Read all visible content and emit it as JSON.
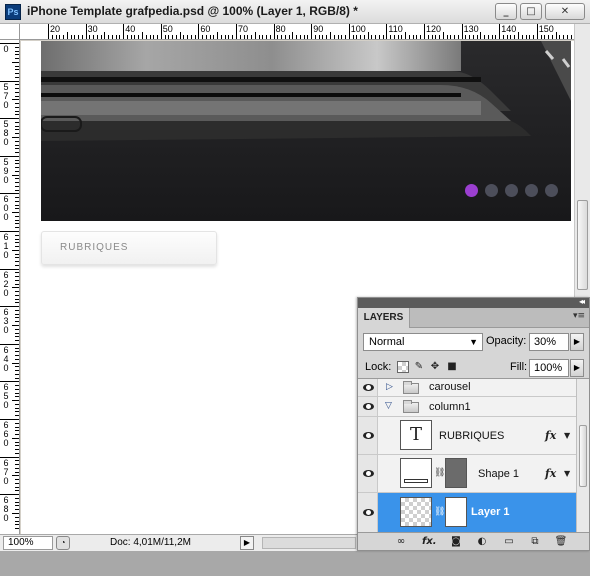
{
  "window": {
    "app_icon": "Ps",
    "title": "iPhone Template grafpedia.psd @ 100% (Layer 1, RGB/8) *",
    "buttons": [
      "minimize-icon",
      "maximize-icon",
      "close-icon"
    ]
  },
  "rulers": {
    "horizontal_labels": [
      "20",
      "30",
      "40",
      "50",
      "60",
      "70",
      "80",
      "90",
      "100",
      "110",
      "120",
      "130",
      "140",
      "150"
    ],
    "vertical_labels": [
      "0",
      "570",
      "580",
      "590",
      "600",
      "610",
      "620",
      "630",
      "640",
      "650",
      "660",
      "670",
      "680"
    ]
  },
  "canvas": {
    "slider_dots": 5,
    "active_dot_index": 0,
    "active_dot_color": "#9b3fd0",
    "inactive_dot_color": "#4c4e5a",
    "rubriques_label": "RUBRIQUES"
  },
  "statusbar": {
    "zoom": "100%",
    "doc_info": "Doc: 4,01M/11,2M"
  },
  "layers_panel": {
    "tab_label": "LAYERS",
    "blend_mode": "Normal",
    "opacity_label": "Opacity:",
    "opacity_value": "30%",
    "lock_label": "Lock:",
    "fill_label": "Fill:",
    "fill_value": "100%",
    "layers": [
      {
        "name": "carousel",
        "kind": "group",
        "expanded": false
      },
      {
        "name": "column1",
        "kind": "group",
        "expanded": true
      },
      {
        "name": "RUBRIQUES",
        "kind": "text",
        "fx": "fx"
      },
      {
        "name": "Shape 1",
        "kind": "shape",
        "fx": "fx"
      },
      {
        "name": "Layer 1",
        "kind": "pixel",
        "selected": true
      }
    ],
    "selected_color": "#3a93ea",
    "footer_icons": [
      "link-icon",
      "fx-icon",
      "mask-icon",
      "adjustment-icon",
      "group-folder-icon",
      "new-layer-icon",
      "trash-icon"
    ]
  }
}
